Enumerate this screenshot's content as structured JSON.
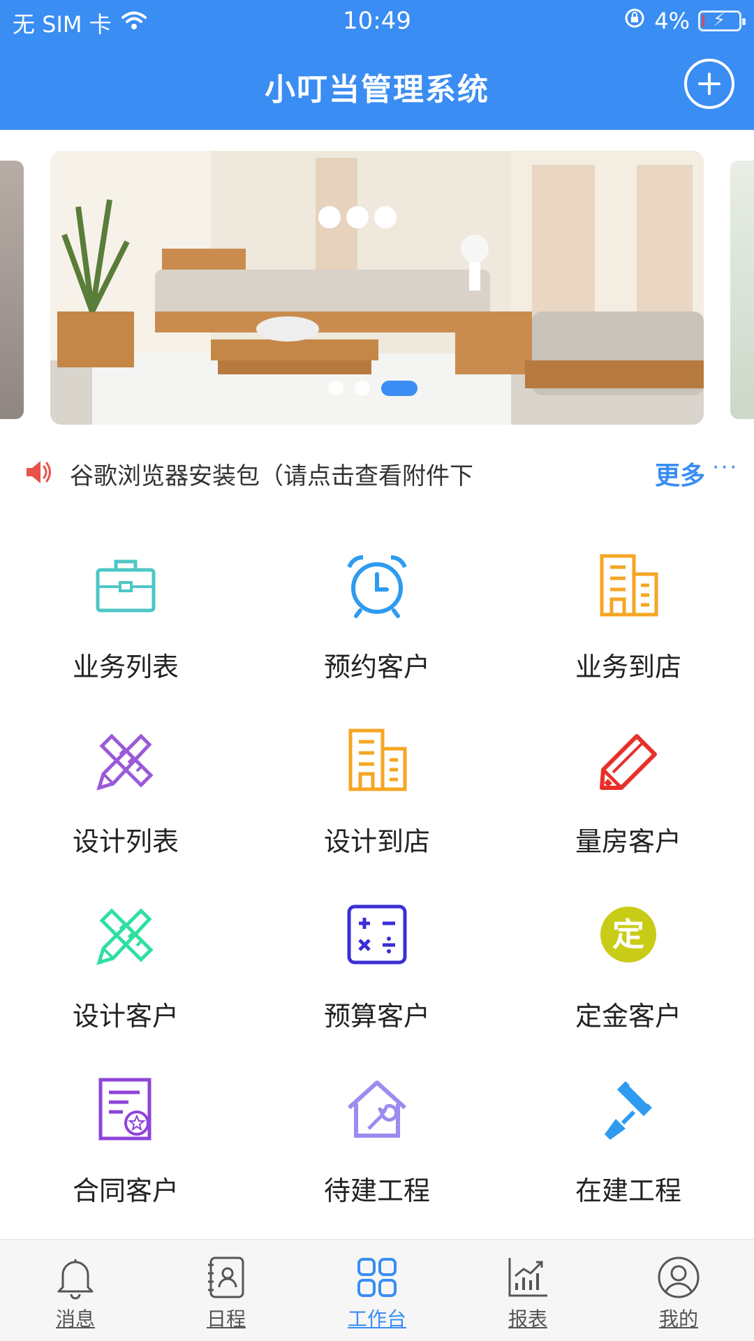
{
  "status_bar": {
    "carrier": "无 SIM 卡",
    "time": "10:49",
    "battery": "4%",
    "battery_level": 0.04
  },
  "header": {
    "title": "小叮当管理系统",
    "add_icon": "plus-circle-icon"
  },
  "banner": {
    "slides": 3,
    "active_index": 2
  },
  "notice": {
    "icon": "speaker-icon",
    "text": "谷歌浏览器安装包（请点击查看附件下",
    "more_label": "更多",
    "more_dots": "···"
  },
  "grid": [
    [
      {
        "label": "业务列表",
        "icon": "briefcase-icon",
        "color": "#4ec6c6"
      },
      {
        "label": "预约客户",
        "icon": "alarm-clock-icon",
        "color": "#2e9bf0"
      },
      {
        "label": "业务到店",
        "icon": "buildings-icon",
        "color": "#f5a623"
      }
    ],
    [
      {
        "label": "设计列表",
        "icon": "pencil-ruler-icon",
        "color": "#9b59d9"
      },
      {
        "label": "设计到店",
        "icon": "buildings-icon",
        "color": "#f5a623"
      },
      {
        "label": "量房客户",
        "icon": "tag-pencil-icon",
        "color": "#e8302a"
      }
    ],
    [
      {
        "label": "设计客户",
        "icon": "pencil-ruler-icon",
        "color": "#2ee0a0"
      },
      {
        "label": "预算客户",
        "icon": "calculator-icon",
        "color": "#3b2fd6"
      },
      {
        "label": "定金客户",
        "icon": "deposit-badge-icon",
        "color": "#c9cc16",
        "badge_text": "定"
      }
    ],
    [
      {
        "label": "合同客户",
        "icon": "contract-icon",
        "color": "#8e44d9"
      },
      {
        "label": "待建工程",
        "icon": "house-wrench-icon",
        "color": "#9a8cf0"
      },
      {
        "label": "在建工程",
        "icon": "paint-roller-icon",
        "color": "#2e9bf0"
      }
    ]
  ],
  "tabs": [
    {
      "label": "消息",
      "icon": "bell-icon",
      "active": false
    },
    {
      "label": "日程",
      "icon": "contacts-book-icon",
      "active": false
    },
    {
      "label": "工作台",
      "icon": "grid-icon",
      "active": true
    },
    {
      "label": "报表",
      "icon": "chart-icon",
      "active": false
    },
    {
      "label": "我的",
      "icon": "user-icon",
      "active": false
    }
  ],
  "colors": {
    "brand": "#3a8df2",
    "tab_inactive": "#555555"
  }
}
